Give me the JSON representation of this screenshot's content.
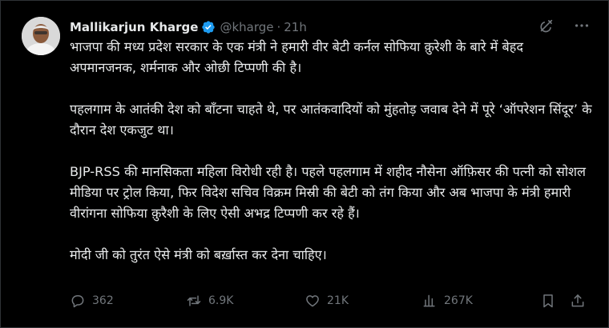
{
  "tweet": {
    "author_name": "Mallikarjun Kharge",
    "handle": "@kharge",
    "separator": "·",
    "time": "21h",
    "paragraphs": [
      "भाजपा की मध्य प्रदेश सरकार के एक मंत्री ने हमारी वीर बेटी कर्नल सोफिया क़ुरेशी के बारे में बेहद अपमानजनक, शर्मनाक और ओछी टिप्पणी की है।",
      "पहलगाम के आतंकी देश को बाँटना चाहते थे, पर आतंकवादियों को मुंहतोड़ जवाब देने में पूरे ‘ऑपरेशन सिंदूर’ के दौरान देश एकजुट था।",
      "BJP-RSS की मानसिकता महिला विरोधी रही है। पहले पहलगाम में शहीद नौसेना ऑफ़िसर की पत्नी को सोशल मीडिया पर ट्रोल किया, फिर विदेश सचिव विक्रम मिस्री की बेटी को तंग किया और अब भाजपा के मंत्री हमारी वीरांगना सोफिया क़ुरैशी के लिए ऐसी अभद्र टिप्पणी कर रहे हैं।",
      "मोदी जी को तुरंत ऐसे मंत्री को बर्ख़ास्त कर देना चाहिए।"
    ],
    "actions": {
      "replies": "362",
      "reposts": "6.9K",
      "likes": "21K",
      "views": "267K"
    }
  },
  "icons": {
    "verified": "verified-badge-icon",
    "grok": "grok-icon",
    "more": "more-icon",
    "reply": "reply-icon",
    "repost": "repost-icon",
    "like": "like-icon",
    "views": "views-icon",
    "bookmark": "bookmark-icon",
    "share": "share-icon"
  },
  "colors": {
    "background": "#000000",
    "text": "#e7e9ea",
    "muted": "#71767b",
    "verified": "#1d9bf0"
  }
}
